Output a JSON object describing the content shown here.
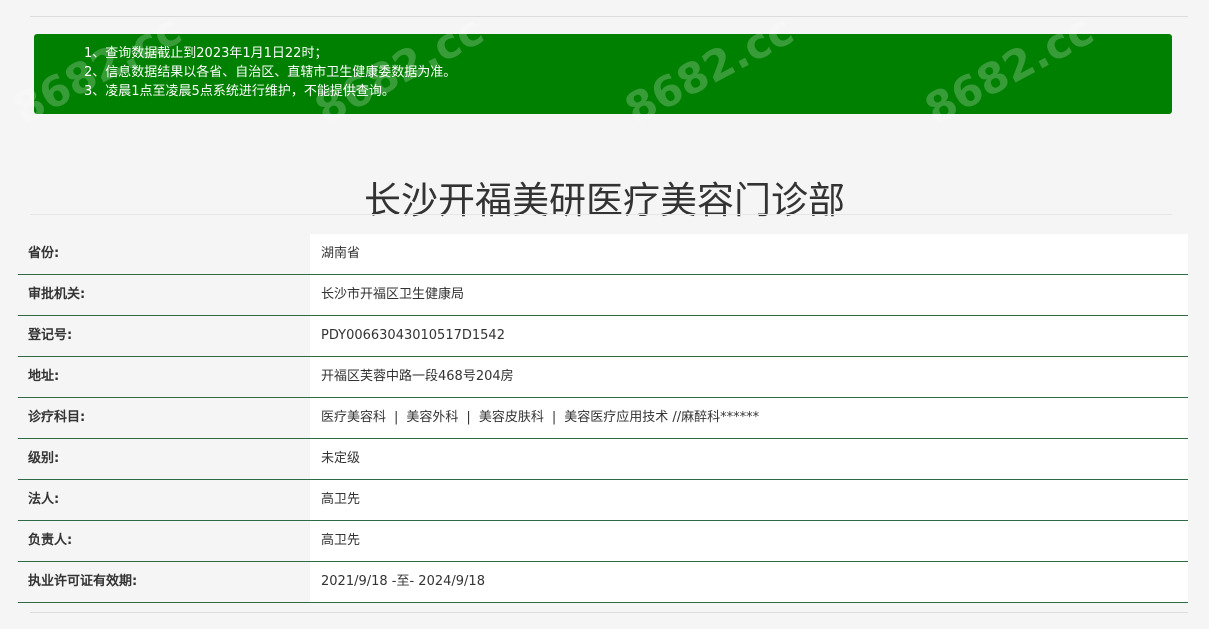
{
  "notice": {
    "lines": [
      "1、查询数据截止到2023年1月1日22时；",
      "2、信息数据结果以各省、自治区、直辖市卫生健康委数据为准。",
      "3、凌晨1点至凌晨5点系统进行维护，不能提供查询。"
    ],
    "watermark": "8682.cc",
    "background": "#008000"
  },
  "page_title": "长沙开福美研医疗美容门诊部",
  "info": {
    "rows": [
      {
        "label": "省份:",
        "value": "湖南省"
      },
      {
        "label": "审批机关:",
        "value": "长沙市开福区卫生健康局"
      },
      {
        "label": "登记号:",
        "value": "PDY00663043010517D1542"
      },
      {
        "label": "地址:",
        "value": "开福区芙蓉中路一段468号204房"
      },
      {
        "label": "诊疗科目:",
        "items": [
          "医疗美容科",
          "美容外科",
          "美容皮肤科",
          "美容医疗应用技术 //麻醉科******"
        ],
        "separator": "|"
      },
      {
        "label": "级别:",
        "value": "未定级"
      },
      {
        "label": "法人:",
        "value": "高卫先"
      },
      {
        "label": "负责人:",
        "value": "高卫先"
      },
      {
        "label": "执业许可证有效期:",
        "value": "2021/9/18 -至- 2024/9/18"
      }
    ],
    "row_border_color": "#2e6b44"
  }
}
